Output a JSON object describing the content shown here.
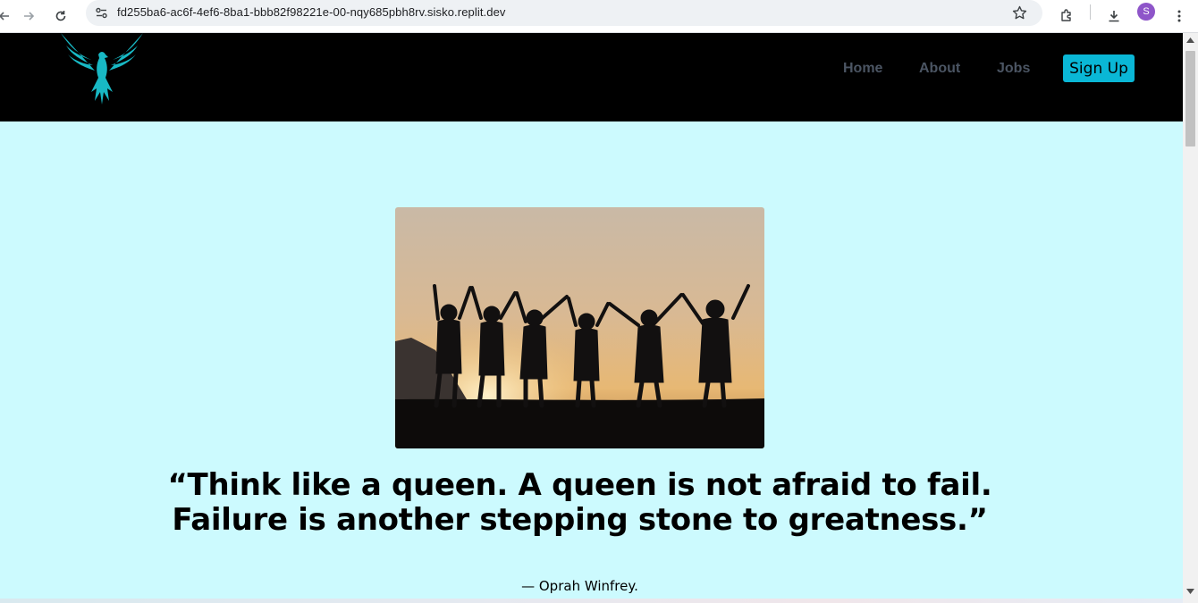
{
  "browser": {
    "url": "fd255ba6-ac6f-4ef6-8ba1-bbb82f98221e-00-nqy685pbh8rv.sisko.replit.dev",
    "profile_initial": "S"
  },
  "nav": {
    "links": [
      "Home",
      "About",
      "Jobs"
    ],
    "signup_label": "Sign Up"
  },
  "hero": {
    "quote_line1": "“Think like a queen. A queen is not afraid to fail.",
    "quote_line2": "Failure is another stepping stone to greatness.”",
    "author": "— Oprah Winfrey."
  },
  "colors": {
    "page_bg": "#ccfafe",
    "navbar_bg": "#000000",
    "accent": "#0ab7d6",
    "logo": "#18b8c4"
  }
}
